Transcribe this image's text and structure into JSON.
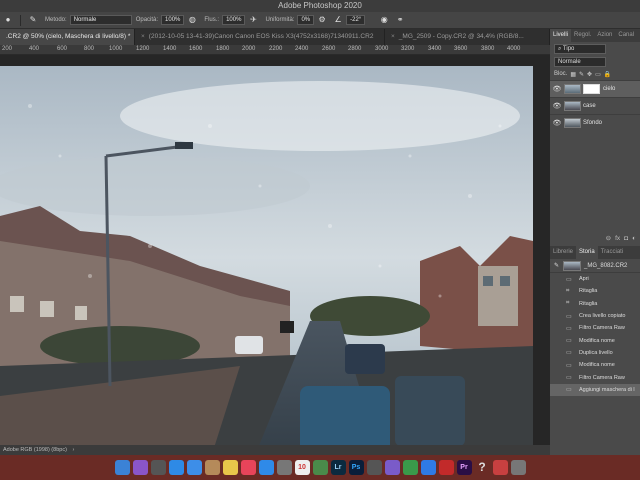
{
  "window": {
    "title": "Adobe Photoshop 2020"
  },
  "options_bar": {
    "mode_label": "Metodo:",
    "mode_value": "Normale",
    "opacity_label": "Opacità:",
    "opacity_value": "100%",
    "flow_label": "Flus.:",
    "flow_value": "100%",
    "smoothing_label": "Uniformità:",
    "smoothing_value": "0%",
    "angle_value": "-22°"
  },
  "doc_tabs": [
    {
      "label": ".CR2 @ 50% (cielo, Maschera di livello/8) *",
      "active": true
    },
    {
      "label": "(2012-10-05 13-41-39)Canon Canon EOS Kiss X3(4752x3168)71340911.CR2",
      "active": false
    },
    {
      "label": "_MG_2509 - Copy.CR2 @ 34,4% (RGB/8...",
      "active": false
    }
  ],
  "ruler": {
    "ticks": [
      "200",
      "400",
      "600",
      "800",
      "1000",
      "1200",
      "1400",
      "1600",
      "1800",
      "2000",
      "2200",
      "2400",
      "2600",
      "2800",
      "3000",
      "3200",
      "3400",
      "3600",
      "3800",
      "4000"
    ]
  },
  "status_bar": {
    "profile": "Adobe RGB (1998) (8bpc)"
  },
  "layers_panel": {
    "tabs": [
      "Livelli",
      "Regol.",
      "Azion",
      "Canal"
    ],
    "filter_value": "Tipo",
    "blend_mode": "Normale",
    "lock_label": "Bloc.",
    "layers": [
      {
        "name": "cielo",
        "selected": true
      },
      {
        "name": "case",
        "selected": false
      },
      {
        "name": "Sfondo",
        "selected": false
      }
    ]
  },
  "history_panel": {
    "tabs": [
      "Librerie",
      "Storia",
      "Tracciati"
    ],
    "source": "_MG_8082.CR2",
    "states": [
      {
        "label": "Apri"
      },
      {
        "label": "Ritaglia"
      },
      {
        "label": "Ritaglia"
      },
      {
        "label": "Crea livello copiato"
      },
      {
        "label": "Filtro Camera Raw"
      },
      {
        "label": "Modifica nome"
      },
      {
        "label": "Duplica livello"
      },
      {
        "label": "Modifica nome"
      },
      {
        "label": "Filtro Camera Raw"
      },
      {
        "label": "Aggiungi maschera di l"
      }
    ]
  },
  "dock": {
    "apps": [
      {
        "icon": "finder-icon",
        "label": "",
        "color": "#3b82d6"
      },
      {
        "icon": "siri-icon",
        "label": "",
        "color": "#8a55c9"
      },
      {
        "icon": "launchpad-icon",
        "label": "",
        "color": "#555"
      },
      {
        "icon": "safari-icon",
        "label": "",
        "color": "#2e8ae6"
      },
      {
        "icon": "mail-icon",
        "label": "",
        "color": "#3d8ee8"
      },
      {
        "icon": "contacts-icon",
        "label": "",
        "color": "#b58a5a"
      },
      {
        "icon": "photos-icon",
        "label": "",
        "color": "#e8c64a"
      },
      {
        "icon": "music-icon",
        "label": "",
        "color": "#e8445a"
      },
      {
        "icon": "appstore-icon",
        "label": "",
        "color": "#2f8ae8"
      },
      {
        "icon": "preview-icon",
        "label": "",
        "color": "#777"
      },
      {
        "icon": "calendar-icon",
        "label": "10",
        "color": "#eee"
      },
      {
        "icon": "time-machine-icon",
        "label": "",
        "color": "#4a8a4a"
      },
      {
        "icon": "lightroom-icon",
        "label": "Lr",
        "color": "#0b2a3f"
      },
      {
        "icon": "photoshop-icon",
        "label": "Ps",
        "color": "#0a1e3a"
      },
      {
        "icon": "pen-icon",
        "label": "",
        "color": "#555"
      },
      {
        "icon": "affinity-icon",
        "label": "",
        "color": "#7a5bc9"
      },
      {
        "icon": "chrome-icon",
        "label": "",
        "color": "#3a9a4a"
      },
      {
        "icon": "dropbox-icon",
        "label": "",
        "color": "#2f7ae5"
      },
      {
        "icon": "acrobat-icon",
        "label": "",
        "color": "#c22a2a"
      },
      {
        "icon": "premiere-icon",
        "label": "Pr",
        "color": "#2a0e45"
      },
      {
        "icon": "help-icon",
        "label": "?",
        "color": "#6a2b25"
      },
      {
        "icon": "flag-icon",
        "label": "",
        "color": "#c84040"
      },
      {
        "icon": "trash-icon",
        "label": "",
        "color": "#777"
      }
    ]
  },
  "colors": {
    "accent": "#2e8ae6",
    "panel": "#4a4a4a",
    "dock": "#6a2b25"
  }
}
